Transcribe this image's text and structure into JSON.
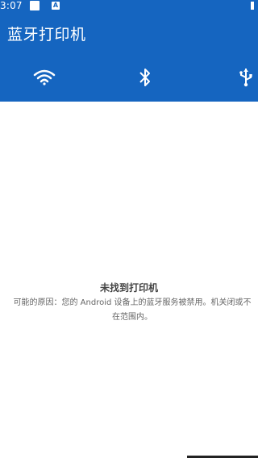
{
  "colors": {
    "brand": "#1565c0",
    "header_text": "#ffffff",
    "empty_title": "#444444",
    "empty_desc": "#666666"
  },
  "statusbar": {
    "time": "3:07",
    "icons": [
      "square-status-icon",
      "a-status-icon",
      "battery-status-icon"
    ]
  },
  "header": {
    "title": "蓝牙打印机"
  },
  "tabs": [
    {
      "icon": "wifi-icon"
    },
    {
      "icon": "bluetooth-icon"
    },
    {
      "icon": "usb-icon"
    }
  ],
  "empty_state": {
    "title": "未找到打印机",
    "description": "可能的原因：您的 Android 设备上的蓝牙服务被禁用。机关闭或不在范围内。"
  }
}
